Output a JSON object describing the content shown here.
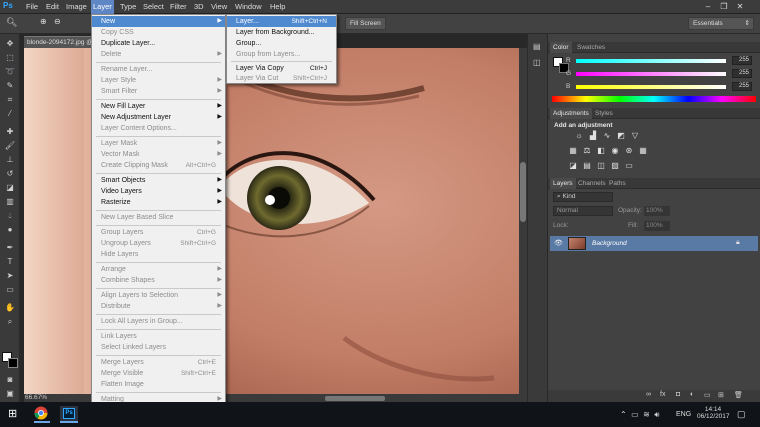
{
  "app": {
    "logo": "Ps"
  },
  "menubar": {
    "items": [
      "File",
      "Edit",
      "Image",
      "Layer",
      "Type",
      "Select",
      "Filter",
      "3D",
      "View",
      "Window",
      "Help"
    ],
    "active": "Layer"
  },
  "optbar": {
    "fill_screen_label": "Fill Screen",
    "workspace": "Essentials"
  },
  "document": {
    "tab_label": "blonde-2094172.jpg @",
    "zoom": "66.67%"
  },
  "layer_menu": {
    "items": [
      {
        "label": "New",
        "shortcut": "",
        "submenu": true,
        "enabled": true,
        "highlighted": true
      },
      {
        "label": "Copy CSS",
        "shortcut": "",
        "submenu": false,
        "enabled": false
      },
      {
        "label": "Duplicate Layer...",
        "shortcut": "",
        "submenu": false,
        "enabled": true
      },
      {
        "label": "Delete",
        "shortcut": "",
        "submenu": true,
        "enabled": false
      },
      {
        "label": "Rename Layer...",
        "shortcut": "",
        "submenu": false,
        "enabled": false
      },
      {
        "label": "Layer Style",
        "shortcut": "",
        "submenu": true,
        "enabled": false
      },
      {
        "label": "Smart Filter",
        "shortcut": "",
        "submenu": true,
        "enabled": false
      },
      {
        "label": "New Fill Layer",
        "shortcut": "",
        "submenu": true,
        "enabled": true
      },
      {
        "label": "New Adjustment Layer",
        "shortcut": "",
        "submenu": true,
        "enabled": true
      },
      {
        "label": "Layer Content Options...",
        "shortcut": "",
        "submenu": false,
        "enabled": false
      },
      {
        "label": "Layer Mask",
        "shortcut": "",
        "submenu": true,
        "enabled": false
      },
      {
        "label": "Vector Mask",
        "shortcut": "",
        "submenu": true,
        "enabled": false
      },
      {
        "label": "Create Clipping Mask",
        "shortcut": "Alt+Ctrl+G",
        "submenu": false,
        "enabled": false
      },
      {
        "label": "Smart Objects",
        "shortcut": "",
        "submenu": true,
        "enabled": true
      },
      {
        "label": "Video Layers",
        "shortcut": "",
        "submenu": true,
        "enabled": true
      },
      {
        "label": "Rasterize",
        "shortcut": "",
        "submenu": true,
        "enabled": true
      },
      {
        "label": "New Layer Based Slice",
        "shortcut": "",
        "submenu": false,
        "enabled": false
      },
      {
        "label": "Group Layers",
        "shortcut": "Ctrl+G",
        "submenu": false,
        "enabled": false
      },
      {
        "label": "Ungroup Layers",
        "shortcut": "Shift+Ctrl+G",
        "submenu": false,
        "enabled": false
      },
      {
        "label": "Hide Layers",
        "shortcut": "",
        "submenu": false,
        "enabled": false
      },
      {
        "label": "Arrange",
        "shortcut": "",
        "submenu": true,
        "enabled": false
      },
      {
        "label": "Combine Shapes",
        "shortcut": "",
        "submenu": true,
        "enabled": false
      },
      {
        "label": "Align Layers to Selection",
        "shortcut": "",
        "submenu": true,
        "enabled": false
      },
      {
        "label": "Distribute",
        "shortcut": "",
        "submenu": true,
        "enabled": false
      },
      {
        "label": "Lock All Layers in Group...",
        "shortcut": "",
        "submenu": false,
        "enabled": false
      },
      {
        "label": "Link Layers",
        "shortcut": "",
        "submenu": false,
        "enabled": false
      },
      {
        "label": "Select Linked Layers",
        "shortcut": "",
        "submenu": false,
        "enabled": false
      },
      {
        "label": "Merge Layers",
        "shortcut": "Ctrl+E",
        "submenu": false,
        "enabled": false
      },
      {
        "label": "Merge Visible",
        "shortcut": "Shift+Ctrl+E",
        "submenu": false,
        "enabled": false
      },
      {
        "label": "Flatten Image",
        "shortcut": "",
        "submenu": false,
        "enabled": false
      },
      {
        "label": "Matting",
        "shortcut": "",
        "submenu": true,
        "enabled": false
      }
    ]
  },
  "new_submenu": {
    "items": [
      {
        "label": "Layer...",
        "shortcut": "Shift+Ctrl+N",
        "enabled": true,
        "highlighted": true
      },
      {
        "label": "Layer from Background...",
        "shortcut": "",
        "enabled": true
      },
      {
        "label": "Group...",
        "shortcut": "",
        "enabled": true
      },
      {
        "label": "Group from Layers...",
        "shortcut": "",
        "enabled": false
      },
      {
        "label": "Layer Via Copy",
        "shortcut": "Ctrl+J",
        "enabled": true
      },
      {
        "label": "Layer Via Cut",
        "shortcut": "Shift+Ctrl+J",
        "enabled": false
      }
    ]
  },
  "color_panel": {
    "tabs": [
      "Color",
      "Swatches"
    ],
    "channels": [
      {
        "label": "R",
        "value": "255",
        "gradient": "#00ffff"
      },
      {
        "label": "G",
        "value": "255",
        "gradient": "#ff00ff"
      },
      {
        "label": "B",
        "value": "255",
        "gradient": "#ffff00"
      }
    ]
  },
  "adjustments_panel": {
    "tabs": [
      "Adjustments",
      "Styles"
    ],
    "heading": "Add an adjustment"
  },
  "layers_panel": {
    "tabs": [
      "Layers",
      "Channels",
      "Paths"
    ],
    "kind_label": "Kind",
    "blend_mode": "Normal",
    "opacity_label": "Opacity:",
    "opacity_value": "100%",
    "lock_label": "Lock:",
    "fill_label": "Fill:",
    "fill_value": "100%",
    "layers": [
      {
        "name": "Background"
      }
    ]
  },
  "taskbar": {
    "lang": "ENG",
    "time": "14:14",
    "date": "06/12/2017"
  },
  "colors": {
    "accent": "#4f89d0",
    "menu_bg": "#f0f0f0",
    "panel_bg": "#424242"
  }
}
